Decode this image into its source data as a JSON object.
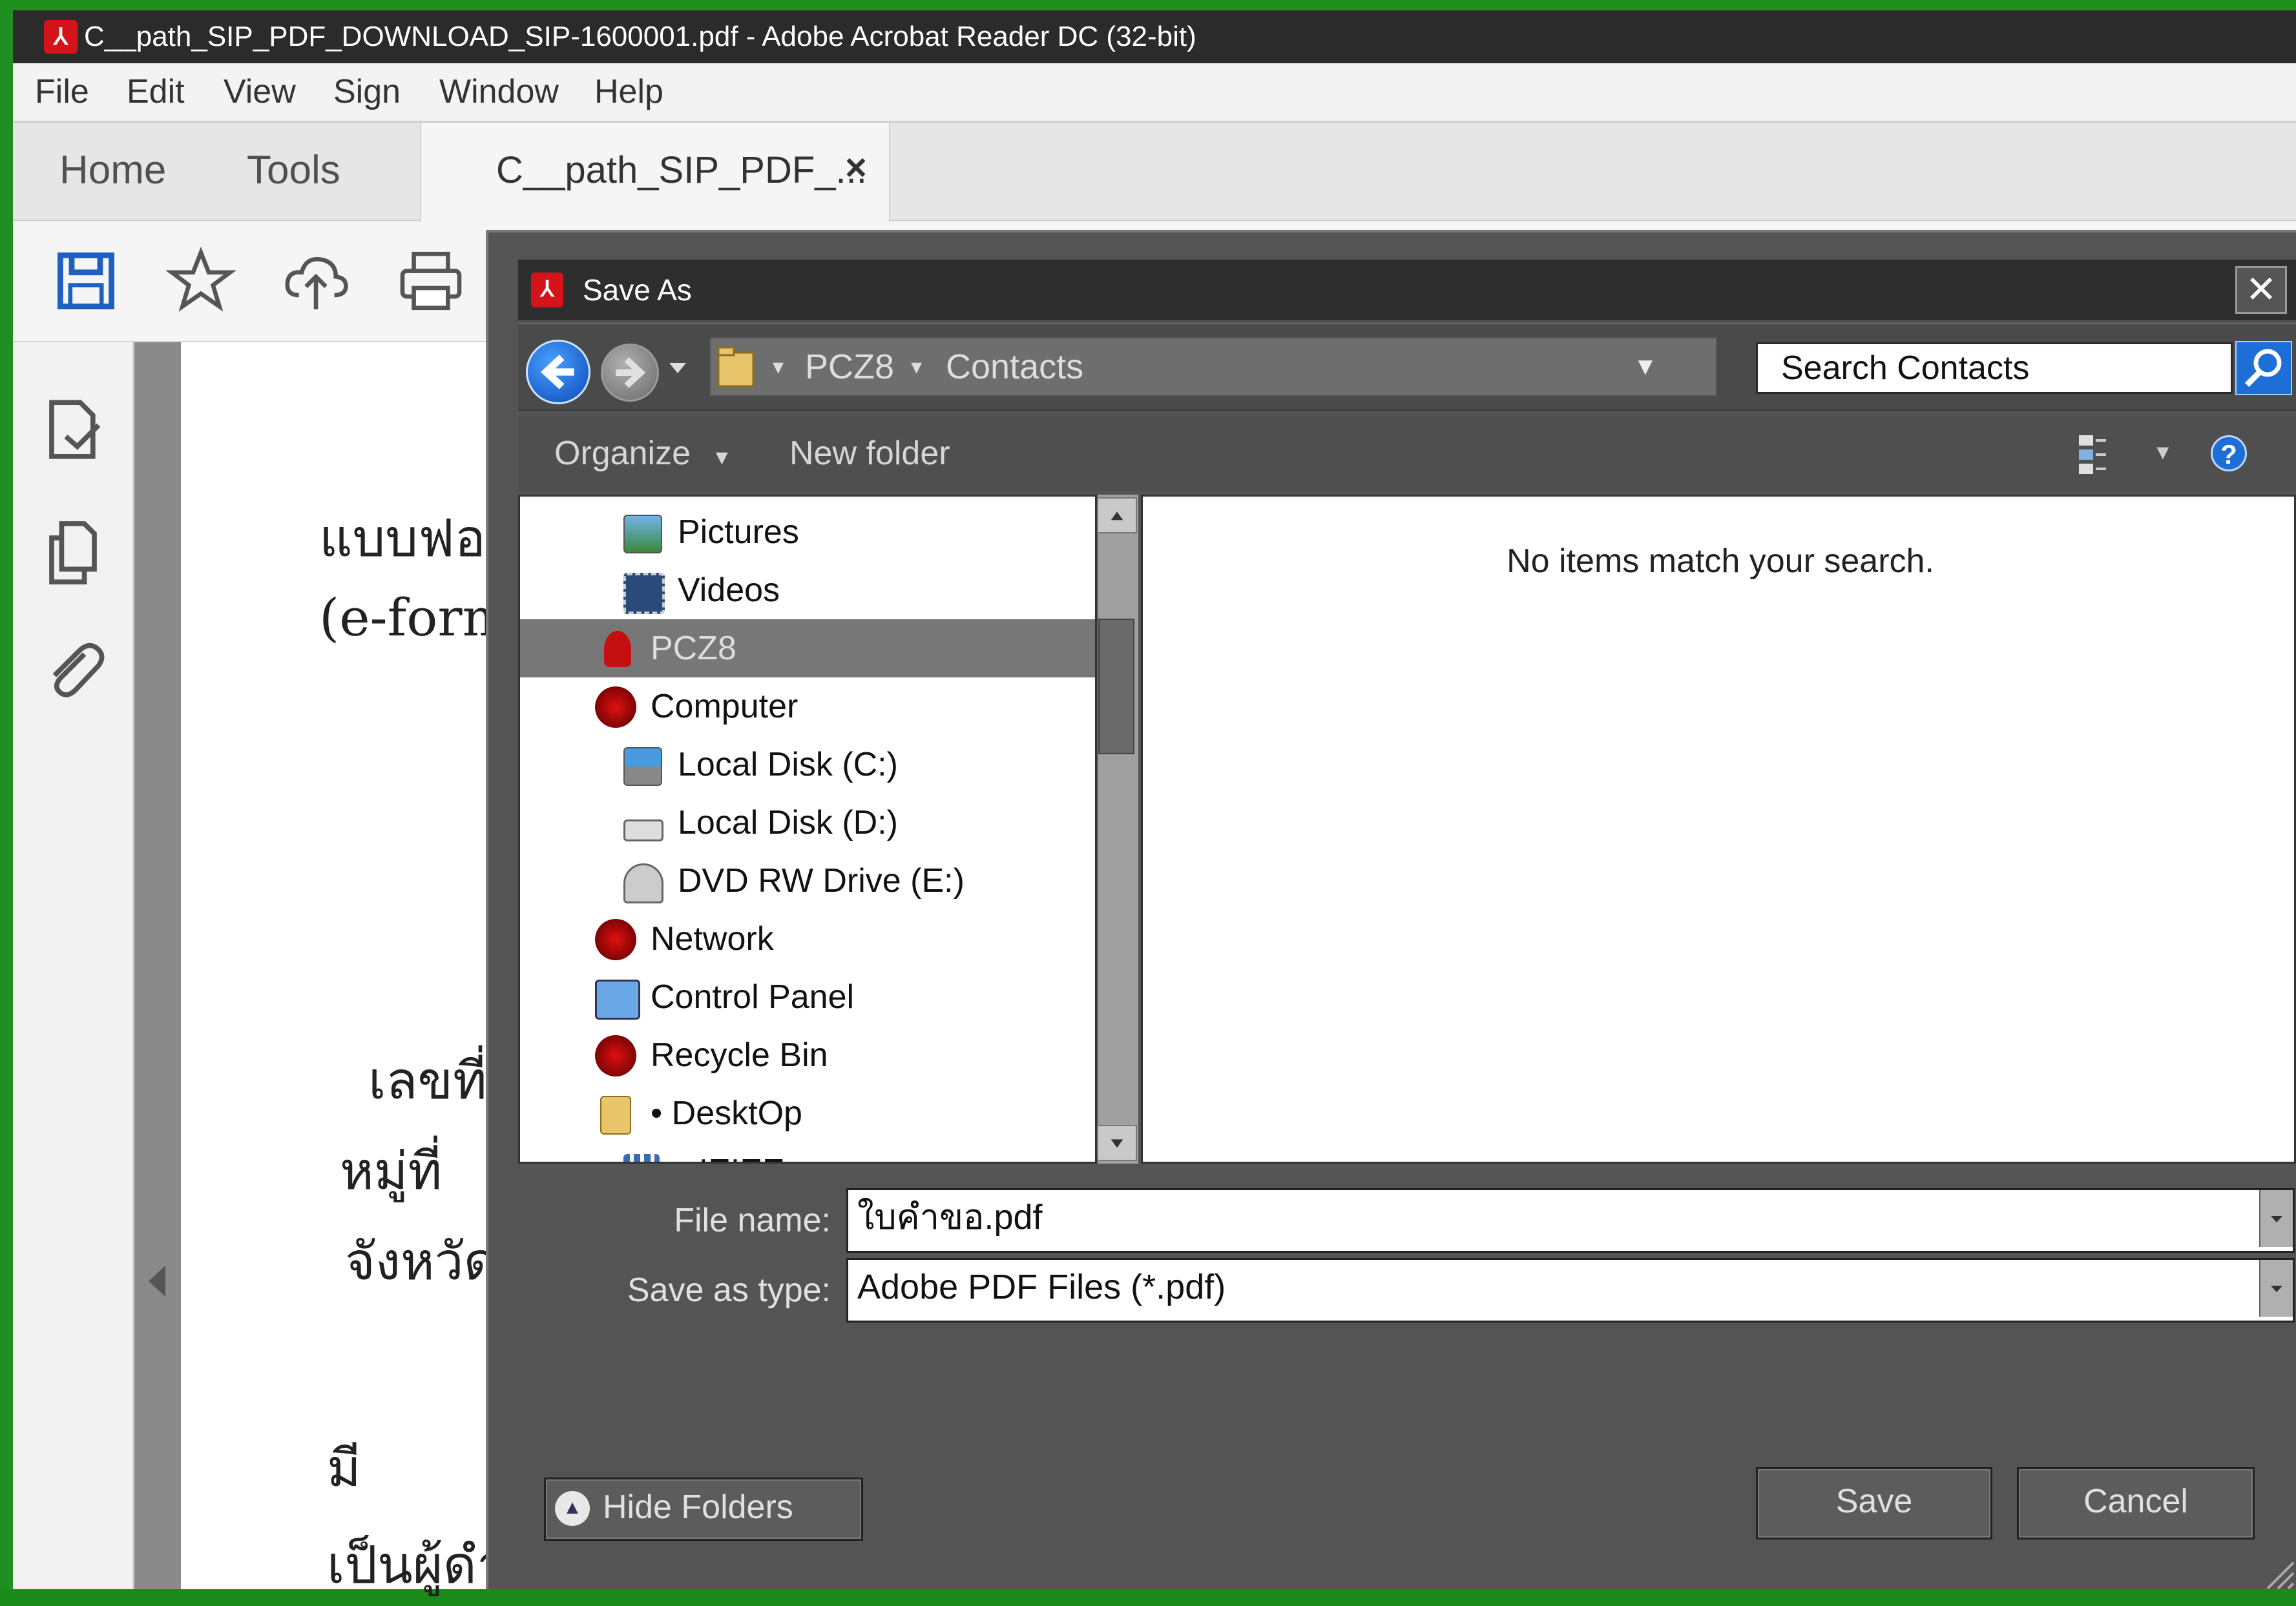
{
  "window": {
    "title": "C__path_SIP_PDF_DOWNLOAD_SIP-1600001.pdf - Adobe Acrobat Reader DC (32-bit)"
  },
  "menubar": {
    "items": [
      "File",
      "Edit",
      "View",
      "Sign",
      "Window",
      "Help"
    ]
  },
  "tabs": {
    "home": "Home",
    "tools": "Tools",
    "document": "C__path_SIP_PDF_...",
    "close_glyph": "×"
  },
  "toolbar_icons": [
    "save-icon",
    "star-icon",
    "cloud-upload-icon",
    "print-icon"
  ],
  "left_rail_icons": [
    "export-pdf-icon",
    "copy-pages-icon",
    "attachment-icon"
  ],
  "document_text": {
    "line1": "แบบฟอ",
    "line2": "(e-form",
    "line3": "เลขที่",
    "line4": "หมู่ที่",
    "line5": "จังหวัด",
    "line6": "มี",
    "line7": "เป็นผู้ดำ"
  },
  "dialog": {
    "title": "Save As",
    "close_glyph": "✕",
    "address": {
      "segments": [
        "PCZ8",
        "Contacts"
      ]
    },
    "search": {
      "placeholder": "Search Contacts"
    },
    "commands": {
      "organize": "Organize",
      "new_folder": "New folder",
      "help_glyph": "?"
    },
    "tree": [
      {
        "label": "Pictures",
        "icon": "pictures-icon"
      },
      {
        "label": "Videos",
        "icon": "videos-icon"
      },
      {
        "label": "PCZ8",
        "icon": "user-icon",
        "selected": true
      },
      {
        "label": "Computer",
        "icon": "computer-icon"
      },
      {
        "label": "Local Disk (C:)",
        "icon": "drive-c-icon"
      },
      {
        "label": "Local Disk (D:)",
        "icon": "drive-d-icon"
      },
      {
        "label": "DVD RW Drive (E:)",
        "icon": "dvd-drive-icon"
      },
      {
        "label": "Network",
        "icon": "network-icon"
      },
      {
        "label": "Control Panel",
        "icon": "control-panel-icon"
      },
      {
        "label": "Recycle Bin",
        "icon": "recycle-bin-icon"
      },
      {
        "label": "• DesktOp",
        "icon": "folder-icon"
      },
      {
        "label": "• IEIEE",
        "icon": "grid-icon"
      }
    ],
    "empty_message": "No items match your search.",
    "file_name": {
      "label": "File name:",
      "value": "ใบคำขอ.pdf"
    },
    "save_as_type": {
      "label": "Save as type:",
      "value": "Adobe PDF Files (*.pdf)"
    },
    "hide_folders": "Hide Folders",
    "save": "Save",
    "cancel": "Cancel"
  },
  "colors": {
    "window_border": "#1f8f1f",
    "title_bg": "#2b2b2b",
    "dialog_bg": "#545454",
    "selection_bg": "#777777",
    "search_button": "#1e6ed8",
    "pdf_red": "#d4141a"
  }
}
